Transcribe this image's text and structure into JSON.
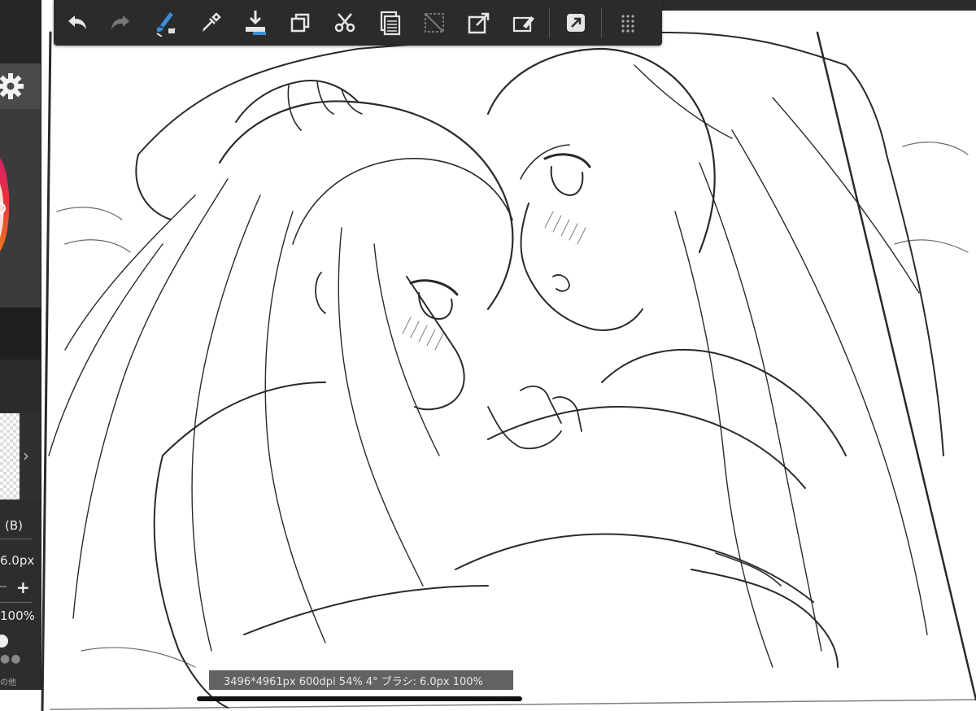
{
  "toolbar": {
    "buttons": [
      {
        "name": "undo-icon",
        "enabled": true
      },
      {
        "name": "redo-icon",
        "enabled": false
      },
      {
        "name": "brush-eraser-toggle-icon",
        "enabled": true
      },
      {
        "name": "eyedropper-icon",
        "enabled": true
      },
      {
        "name": "download-icon",
        "enabled": true
      },
      {
        "name": "copy-icon",
        "enabled": true
      },
      {
        "name": "scissors-icon",
        "enabled": true
      },
      {
        "name": "paste-icon",
        "enabled": true
      },
      {
        "name": "deselect-icon",
        "enabled": false
      },
      {
        "name": "transform-icon",
        "enabled": true
      },
      {
        "name": "clear-icon",
        "enabled": true
      },
      {
        "name": "share-icon",
        "enabled": true
      },
      {
        "name": "grid-menu-icon",
        "enabled": true
      }
    ]
  },
  "left_panel": {
    "gear_icon": "gear-icon",
    "brush_label": "(B)",
    "brush_size": "6.0px",
    "plus_label": "+",
    "opacity": "100%",
    "bottom_label": "の他"
  },
  "status_bar": {
    "text": "3496*4961px 600dpi 54% 4° ブラシ: 6.0px 100%"
  },
  "colors": {
    "toolbar_bg": "#2b2b2b",
    "accent_blue": "#3a8fd8",
    "color_wheel_red": "#e8303a",
    "color_wheel_orange": "#f07a1a"
  }
}
